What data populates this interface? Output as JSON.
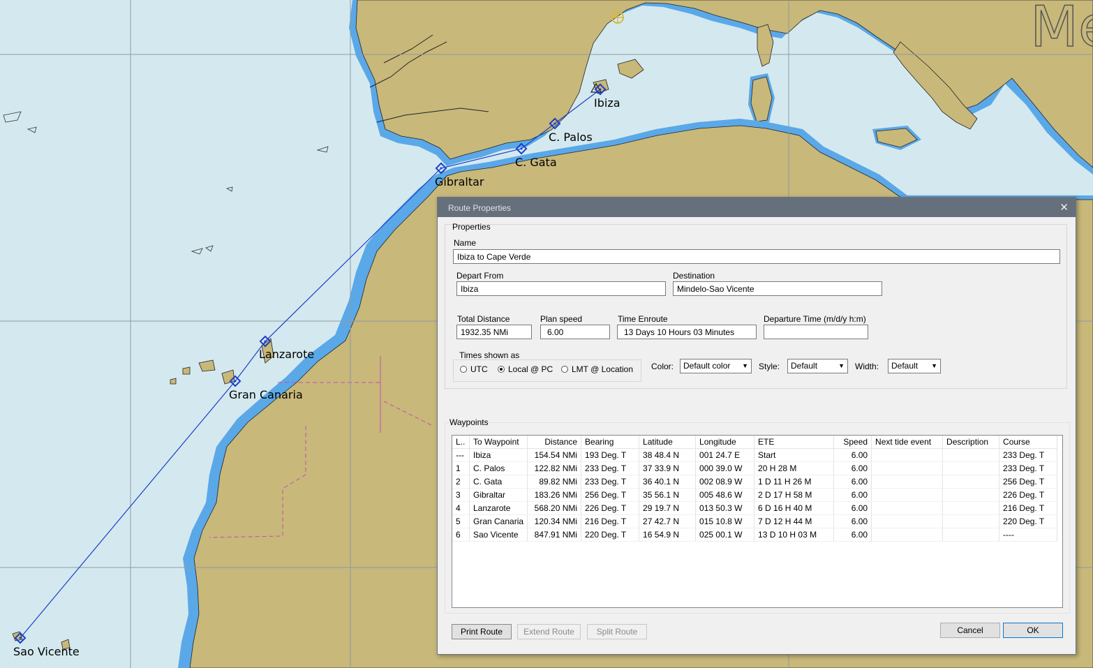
{
  "map": {
    "title_glyph": "Me",
    "waypoints": [
      {
        "name": "Ibiza"
      },
      {
        "name": "C. Palos"
      },
      {
        "name": "C. Gata"
      },
      {
        "name": "Gibraltar"
      },
      {
        "name": "Lanzarote"
      },
      {
        "name": "Gran Canaria"
      },
      {
        "name": "Sao Vicente"
      }
    ],
    "colors": {
      "sea": "#d4e9ef",
      "shallow": "#5aa8e8",
      "land": "#c8b87a",
      "route": "#1c3fc8",
      "grid": "#8c9aa0"
    }
  },
  "dialog": {
    "title": "Route Properties",
    "close_glyph": "✕",
    "properties_label": "Properties",
    "name_label": "Name",
    "name_value": "Ibiza to Cape Verde",
    "depart_label": "Depart From",
    "depart_value": "Ibiza",
    "destination_label": "Destination",
    "destination_value": "Mindelo-Sao Vicente",
    "total_distance_label": "Total Distance",
    "total_distance_value": "1932.35 NMi",
    "plan_speed_label": "Plan speed",
    "plan_speed_value": "6.00",
    "time_enroute_label": "Time Enroute",
    "time_enroute_value": "13 Days  10 Hours  03 Minutes",
    "departure_time_label": "Departure Time (m/d/y h:m)",
    "departure_time_value": "",
    "times_shown_label": "Times shown as",
    "radio_utc": "UTC",
    "radio_local": "Local @ PC",
    "radio_lmt": "LMT @ Location",
    "selected_time_mode": "Local @ PC",
    "color_label": "Color:",
    "color_value": "Default color",
    "style_label": "Style:",
    "style_value": "Default",
    "width_label": "Width:",
    "width_value": "Default",
    "waypoints_label": "Waypoints",
    "table": {
      "headers": [
        "L..",
        "To Waypoint",
        "Distance",
        "Bearing",
        "Latitude",
        "Longitude",
        "ETE",
        "Speed",
        "Next tide event",
        "Description",
        "Course"
      ],
      "rows": [
        [
          "---",
          "Ibiza",
          "154.54 NMi",
          "193 Deg. T",
          "38 48.4 N",
          "001 24.7 E",
          "Start",
          "6.00",
          "",
          "",
          "233 Deg. T"
        ],
        [
          "1",
          "C. Palos",
          "122.82 NMi",
          "233 Deg. T",
          "37 33.9 N",
          "000 39.0 W",
          " 20 H  28 M",
          "6.00",
          "",
          "",
          "233 Deg. T"
        ],
        [
          "2",
          "C. Gata",
          "89.82 NMi",
          "233 Deg. T",
          "36 40.1 N",
          "002 08.9 W",
          " 1 D  11 H  26 M",
          "6.00",
          "",
          "",
          "256 Deg. T"
        ],
        [
          "3",
          "Gibraltar",
          "183.26 NMi",
          "256 Deg. T",
          "35 56.1 N",
          "005 48.6 W",
          " 2 D  17 H  58 M",
          "6.00",
          "",
          "",
          "226 Deg. T"
        ],
        [
          "4",
          "Lanzarote",
          "568.20 NMi",
          "226 Deg. T",
          "29 19.7 N",
          "013 50.3 W",
          " 6 D  16 H  40 M",
          "6.00",
          "",
          "",
          "216 Deg. T"
        ],
        [
          "5",
          "Gran Canaria",
          "120.34 NMi",
          "216 Deg. T",
          "27 42.7 N",
          "015 10.8 W",
          " 7 D  12 H  44 M",
          "6.00",
          "",
          "",
          "220 Deg. T"
        ],
        [
          "6",
          "Sao Vicente",
          "847.91 NMi",
          "220 Deg. T",
          "16 54.9 N",
          "025 00.1 W",
          " 13 D  10 H  03 M",
          "6.00",
          "",
          "",
          "----"
        ]
      ]
    },
    "buttons": {
      "print": "Print Route",
      "extend": "Extend Route",
      "split": "Split Route",
      "cancel": "Cancel",
      "ok": "OK"
    }
  }
}
